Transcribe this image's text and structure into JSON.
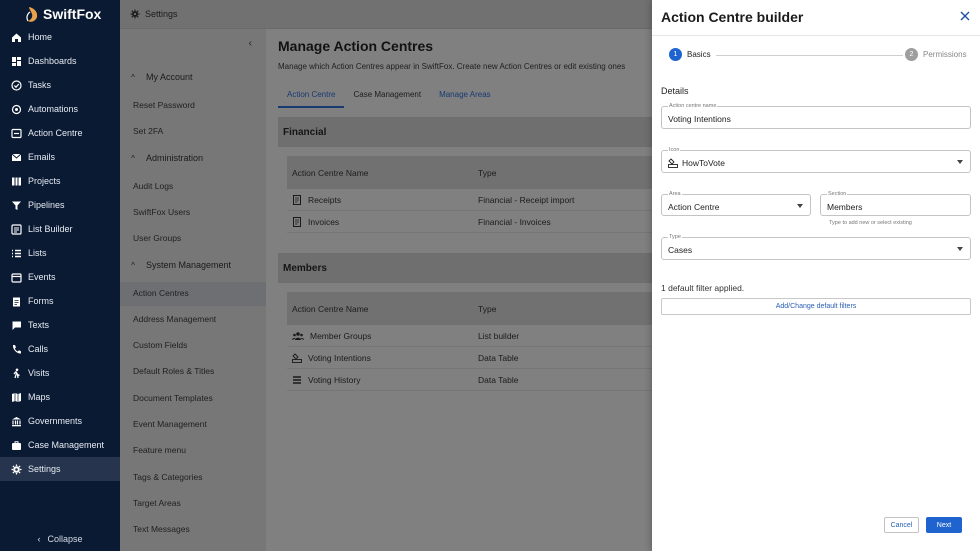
{
  "app": {
    "name": "SwiftFox",
    "brand_color": "#0b1a33",
    "accent": "#1f63cf"
  },
  "sidebar": {
    "items": [
      {
        "label": "Home",
        "icon": "home-icon"
      },
      {
        "label": "Dashboards",
        "icon": "dashboard-icon"
      },
      {
        "label": "Tasks",
        "icon": "check-circle-icon"
      },
      {
        "label": "Automations",
        "icon": "automation-icon"
      },
      {
        "label": "Action Centre",
        "icon": "action-centre-icon"
      },
      {
        "label": "Emails",
        "icon": "mail-icon"
      },
      {
        "label": "Projects",
        "icon": "projects-icon"
      },
      {
        "label": "Pipelines",
        "icon": "filter-icon"
      },
      {
        "label": "List Builder",
        "icon": "list-builder-icon"
      },
      {
        "label": "Lists",
        "icon": "list-icon"
      },
      {
        "label": "Events",
        "icon": "events-icon"
      },
      {
        "label": "Forms",
        "icon": "clipboard-icon"
      },
      {
        "label": "Texts",
        "icon": "chat-icon"
      },
      {
        "label": "Calls",
        "icon": "phone-icon"
      },
      {
        "label": "Visits",
        "icon": "walk-icon"
      },
      {
        "label": "Maps",
        "icon": "map-icon"
      },
      {
        "label": "Governments",
        "icon": "bank-icon"
      },
      {
        "label": "Case Management",
        "icon": "briefcase-icon"
      },
      {
        "label": "Settings",
        "icon": "gear-icon"
      }
    ],
    "collapse_label": "Collapse"
  },
  "topbar": {
    "title": "Settings"
  },
  "settings_menu": {
    "groups": [
      {
        "title": "My Account",
        "items": [
          "Reset Password",
          "Set 2FA"
        ]
      },
      {
        "title": "Administration",
        "items": [
          "Audit Logs",
          "SwiftFox Users",
          "User Groups"
        ]
      },
      {
        "title": "System Management",
        "items": [
          "Action Centres",
          "Address Management",
          "Custom Fields",
          "Default Roles & Titles",
          "Document Templates",
          "Event Management",
          "Feature menu",
          "Tags & Categories",
          "Target Areas",
          "Text Messages"
        ]
      }
    ]
  },
  "main": {
    "title": "Manage Action Centres",
    "subtitle": "Manage which Action Centres appear in SwiftFox. Create new Action Centres or edit existing ones",
    "tabs": [
      "Action Centre",
      "Case Management",
      "Manage Areas"
    ],
    "sections": [
      {
        "title": "Financial",
        "columns": [
          "Action Centre Name",
          "Type"
        ],
        "rows": [
          {
            "name": "Receipts",
            "type": "Financial - Receipt import",
            "icon": "receipt-icon"
          },
          {
            "name": "Invoices",
            "type": "Financial - Invoices",
            "icon": "invoice-icon"
          }
        ]
      },
      {
        "title": "Members",
        "columns": [
          "Action Centre Name",
          "Type"
        ],
        "rows": [
          {
            "name": "Member Groups",
            "type": "List builder",
            "icon": "group-icon"
          },
          {
            "name": "Voting Intentions",
            "type": "Data Table",
            "icon": "ballot-icon"
          },
          {
            "name": "Voting History",
            "type": "Data Table",
            "icon": "lines-icon"
          }
        ]
      }
    ]
  },
  "drawer": {
    "title": "Action Centre builder",
    "steps": [
      {
        "num": "1",
        "label": "Basics"
      },
      {
        "num": "2",
        "label": "Permissions"
      }
    ],
    "section_label": "Details",
    "fields": {
      "name": {
        "label": "Action centre name",
        "value": "Voting Intentions"
      },
      "icon": {
        "label": "Icon",
        "value": "HowToVote"
      },
      "area": {
        "label": "Area",
        "value": "Action Centre"
      },
      "section": {
        "label": "Section",
        "value": "Members",
        "hint": "Type to add new or select existing"
      },
      "type": {
        "label": "Type",
        "value": "Cases"
      }
    },
    "filter_note": "1 default filter applied.",
    "filter_button": "Add/Change default filters",
    "cancel_label": "Cancel",
    "next_label": "Next"
  }
}
